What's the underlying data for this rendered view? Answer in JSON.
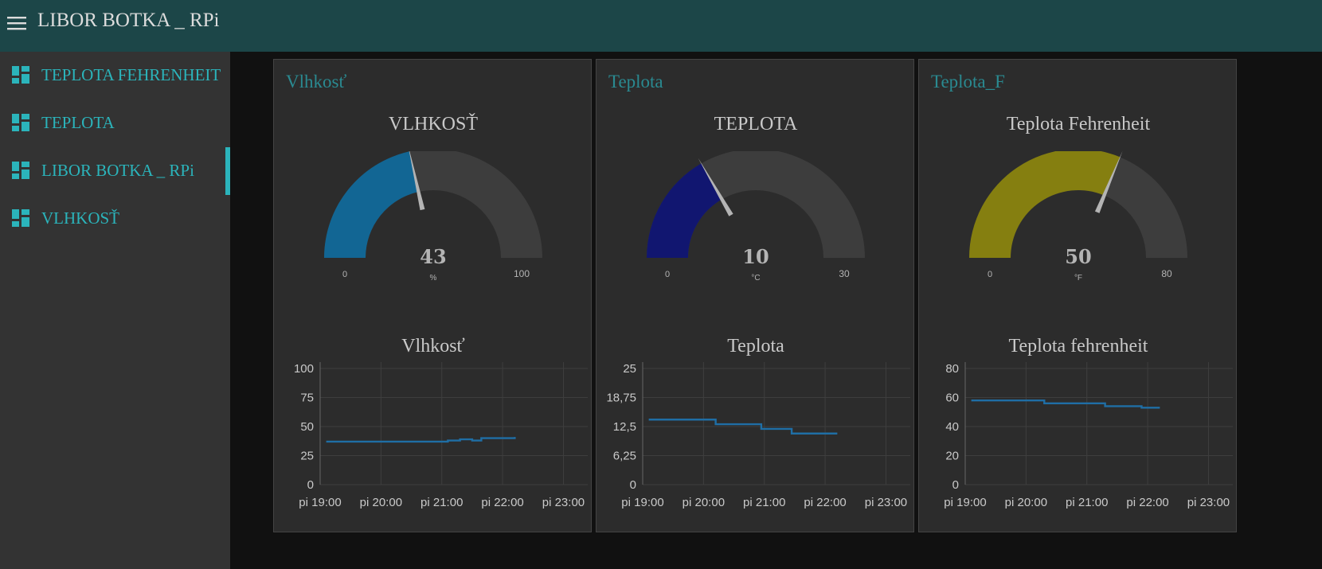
{
  "header": {
    "title": "LIBOR BOTKA _ RPi",
    "menu_icon": "menu-icon"
  },
  "sidebar": {
    "items": [
      {
        "label": "TEPLOTA FEHRENHEIT",
        "icon": "dashboard-icon",
        "active": false
      },
      {
        "label": "TEPLOTA",
        "icon": "dashboard-icon",
        "active": false
      },
      {
        "label": "LIBOR BOTKA _ RPi",
        "icon": "dashboard-icon",
        "active": true
      },
      {
        "label": "VLHKOSŤ",
        "icon": "dashboard-icon",
        "active": false
      }
    ]
  },
  "colors": {
    "accent": "#2bb4bb",
    "gauge_track": "#3d3d3d",
    "series": "#1f6ea5"
  },
  "groups": [
    {
      "title": "Vlhkosť",
      "gauge": {
        "title": "VLHKOSŤ",
        "value": 43,
        "min": 0,
        "max": 100,
        "unit": "%",
        "color": "#126694"
      },
      "chart": {
        "title": "Vlhkosť",
        "yticks": [
          "100",
          "75",
          "50",
          "25",
          "0"
        ],
        "xticks": [
          "pi 19:00",
          "pi 20:00",
          "pi 21:00",
          "pi 22:00",
          "pi 23:00"
        ]
      }
    },
    {
      "title": "Teplota",
      "gauge": {
        "title": "TEPLOTA",
        "value": 10,
        "min": 0,
        "max": 30,
        "unit": "°C",
        "color": "#111670"
      },
      "chart": {
        "title": "Teplota",
        "yticks": [
          "25",
          "18,75",
          "12,5",
          "6,25",
          "0"
        ],
        "xticks": [
          "pi 19:00",
          "pi 20:00",
          "pi 21:00",
          "pi 22:00",
          "pi 23:00"
        ]
      }
    },
    {
      "title": "Teplota_F",
      "gauge": {
        "title": "Teplota Fehrenheit",
        "value": 50,
        "min": 0,
        "max": 80,
        "unit": "°F",
        "color": "#857f10"
      },
      "chart": {
        "title": "Teplota fehrenheit",
        "yticks": [
          "80",
          "60",
          "40",
          "20",
          "0"
        ],
        "xticks": [
          "pi 19:00",
          "pi 20:00",
          "pi 21:00",
          "pi 22:00",
          "pi 23:00"
        ]
      }
    }
  ],
  "chart_data": [
    {
      "type": "line",
      "title": "Vlhkosť",
      "ylim": [
        0,
        100
      ],
      "xlim": [
        19,
        23.4
      ],
      "grid": true,
      "series": [
        {
          "x": [
            19.1,
            19.5,
            20.0,
            20.5,
            21.0,
            21.1,
            21.3,
            21.5,
            21.65,
            21.85,
            22.0,
            22.2
          ],
          "y": [
            37,
            37,
            37,
            37,
            37,
            38,
            39,
            38,
            40,
            40,
            40,
            41
          ]
        }
      ]
    },
    {
      "type": "line",
      "title": "Teplota",
      "ylim": [
        0,
        25
      ],
      "xlim": [
        19,
        23.4
      ],
      "grid": true,
      "series": [
        {
          "x": [
            19.1,
            19.5,
            20.0,
            20.2,
            20.5,
            20.95,
            21.45,
            22.0,
            22.2
          ],
          "y": [
            14,
            14,
            14,
            13,
            13,
            12,
            11,
            11,
            11
          ]
        }
      ]
    },
    {
      "type": "line",
      "title": "Teplota fehrenheit",
      "ylim": [
        0,
        80
      ],
      "xlim": [
        19,
        23.4
      ],
      "grid": true,
      "series": [
        {
          "x": [
            19.1,
            19.5,
            20.0,
            20.3,
            20.6,
            21.0,
            21.3,
            21.6,
            21.9,
            22.2
          ],
          "y": [
            58,
            58,
            58,
            56,
            56,
            56,
            54,
            54,
            53,
            53
          ]
        }
      ]
    }
  ]
}
